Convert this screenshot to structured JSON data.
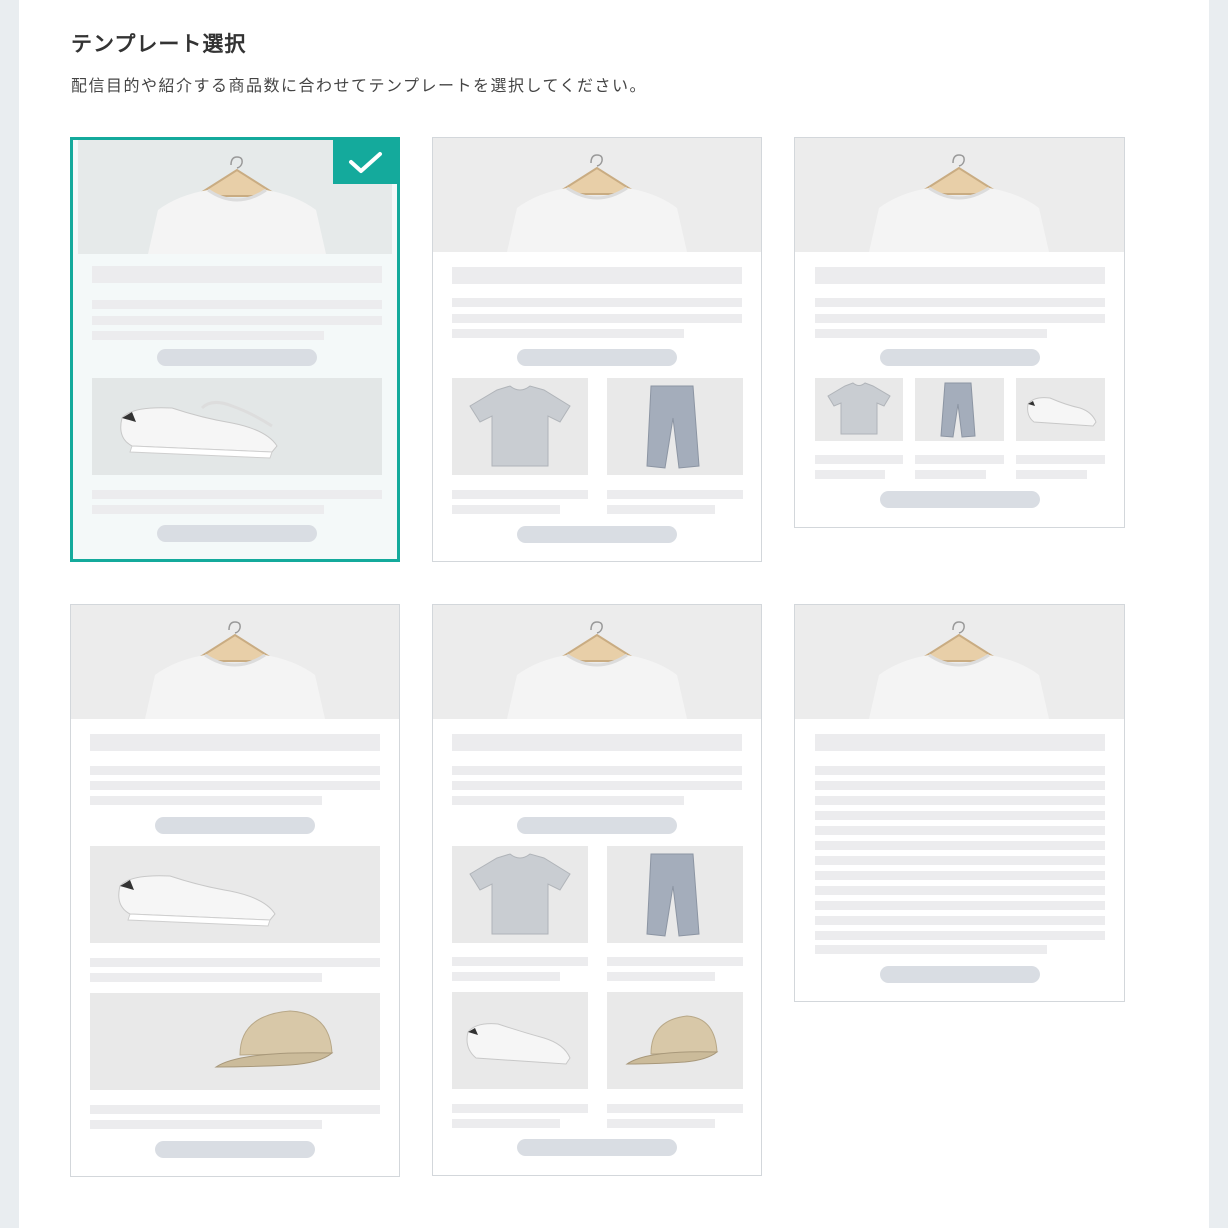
{
  "header": {
    "title": "テンプレート選択",
    "description": "配信目的や紹介する商品数に合わせてテンプレートを選択してください。"
  },
  "templates": [
    {
      "id": "1",
      "selected": true
    },
    {
      "id": "2",
      "selected": false
    },
    {
      "id": "3",
      "selected": false
    },
    {
      "id": "4",
      "selected": false
    },
    {
      "id": "5",
      "selected": false
    },
    {
      "id": "6",
      "selected": false
    }
  ],
  "icons": {
    "selected": "checkmark-icon",
    "hero": "sweater-on-hanger",
    "products": [
      "sneakers",
      "tshirt",
      "jeans",
      "cap"
    ]
  },
  "colors": {
    "accent": "#14aa9c",
    "border": "#d3d7db",
    "placeholder": "#ececee",
    "button": "#d9dde3"
  }
}
